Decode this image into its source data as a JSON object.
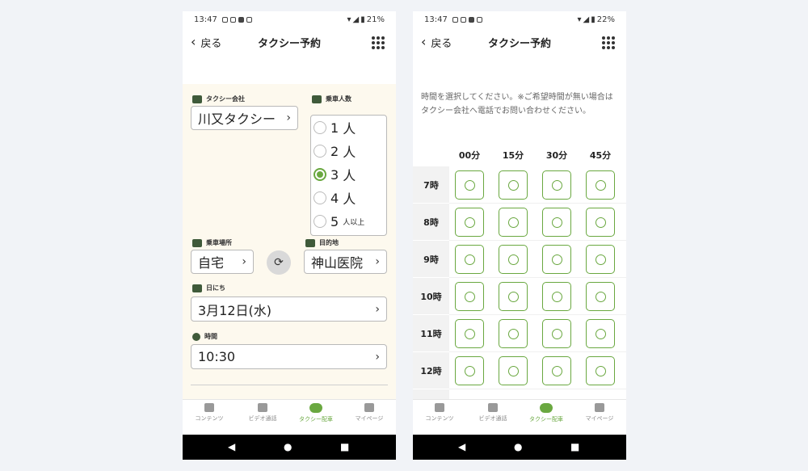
{
  "screen1": {
    "status": {
      "time": "13:47",
      "battery": "21%"
    },
    "appbar": {
      "back": "戻る",
      "title": "タクシー予約"
    },
    "company_label": "タクシー会社",
    "company_value": "川又タクシー",
    "passengers_label": "乗車人数",
    "passengers": [
      {
        "n": "1",
        "unit": "人",
        "selected": false
      },
      {
        "n": "2",
        "unit": "人",
        "selected": false
      },
      {
        "n": "3",
        "unit": "人",
        "selected": true
      },
      {
        "n": "4",
        "unit": "人",
        "selected": false
      },
      {
        "n": "5",
        "unit": "人以上",
        "selected": false
      }
    ],
    "pickup_label": "乗車場所",
    "pickup_value": "自宅",
    "destination_label": "目的地",
    "destination_value": "神山医院",
    "date_label": "日にち",
    "date_value": "3月12日(水)",
    "time_label": "時間",
    "time_value": "10:30"
  },
  "screen2": {
    "status": {
      "time": "13:47",
      "battery": "22%"
    },
    "appbar": {
      "back": "戻る",
      "title": "タクシー予約"
    },
    "instructions": "時間を選択してください。※ご希望時間が無い場合はタクシー会社へ電話でお問い合わせください。",
    "minutes": [
      "00分",
      "15分",
      "30分",
      "45分"
    ],
    "hours": [
      "7時",
      "8時",
      "9時",
      "10時",
      "11時",
      "12時"
    ]
  },
  "nav": {
    "items": [
      "コンテンツ",
      "ビデオ通話",
      "タクシー配車",
      "マイページ"
    ],
    "active_index": 2,
    "accent": "#6aa840"
  },
  "system_nav": {
    "back": "◀",
    "home": "●",
    "recents": "■"
  }
}
